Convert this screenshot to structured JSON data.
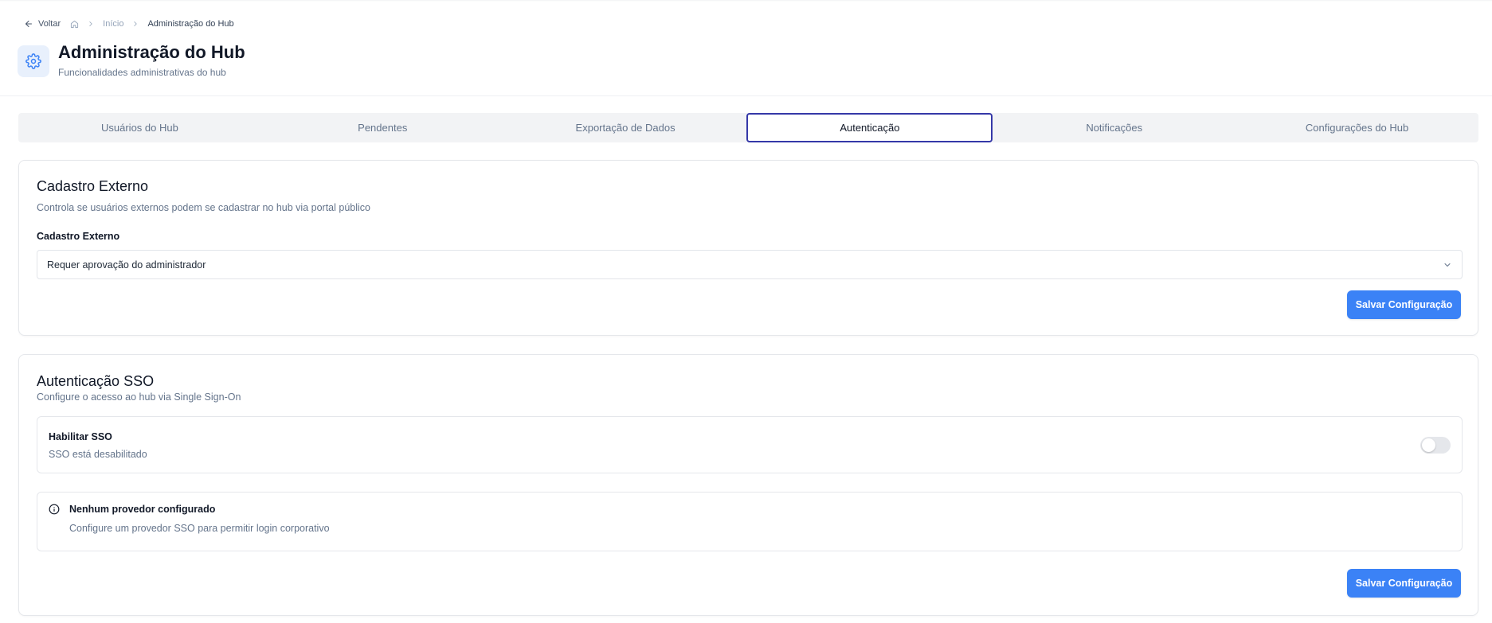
{
  "breadcrumb": {
    "back_label": "Voltar",
    "home_link": "Início",
    "current": "Administração do Hub"
  },
  "page": {
    "title": "Administração do Hub",
    "subtitle": "Funcionalidades administrativas do hub",
    "icon": "gear-icon"
  },
  "tabs": [
    {
      "label": "Usuários do Hub",
      "active": false
    },
    {
      "label": "Pendentes",
      "active": false
    },
    {
      "label": "Exportação de Dados",
      "active": false
    },
    {
      "label": "Autenticação",
      "active": true
    },
    {
      "label": "Notificações",
      "active": false
    },
    {
      "label": "Configurações do Hub",
      "active": false
    }
  ],
  "external_signup": {
    "title": "Cadastro Externo",
    "description": "Controla se usuários externos podem se cadastrar no hub via portal público",
    "field_label": "Cadastro Externo",
    "selected_value": "Requer aprovação do administrador",
    "save_label": "Salvar Configuração"
  },
  "sso": {
    "title": "Autenticação SSO",
    "description": "Configure o acesso ao hub via Single Sign-On",
    "toggle_label": "Habilitar SSO",
    "toggle_status": "SSO está desabilitado",
    "toggle_on": false,
    "info_title": "Nenhum provedor configurado",
    "info_text": "Configure um provedor SSO para permitir login corporativo",
    "save_label": "Salvar Configuração"
  },
  "colors": {
    "accent": "#3b82f6",
    "active_tab_border": "#3538a8",
    "tab_bar_bg": "#f2f3f5",
    "icon_bg": "#e8f0fc"
  }
}
